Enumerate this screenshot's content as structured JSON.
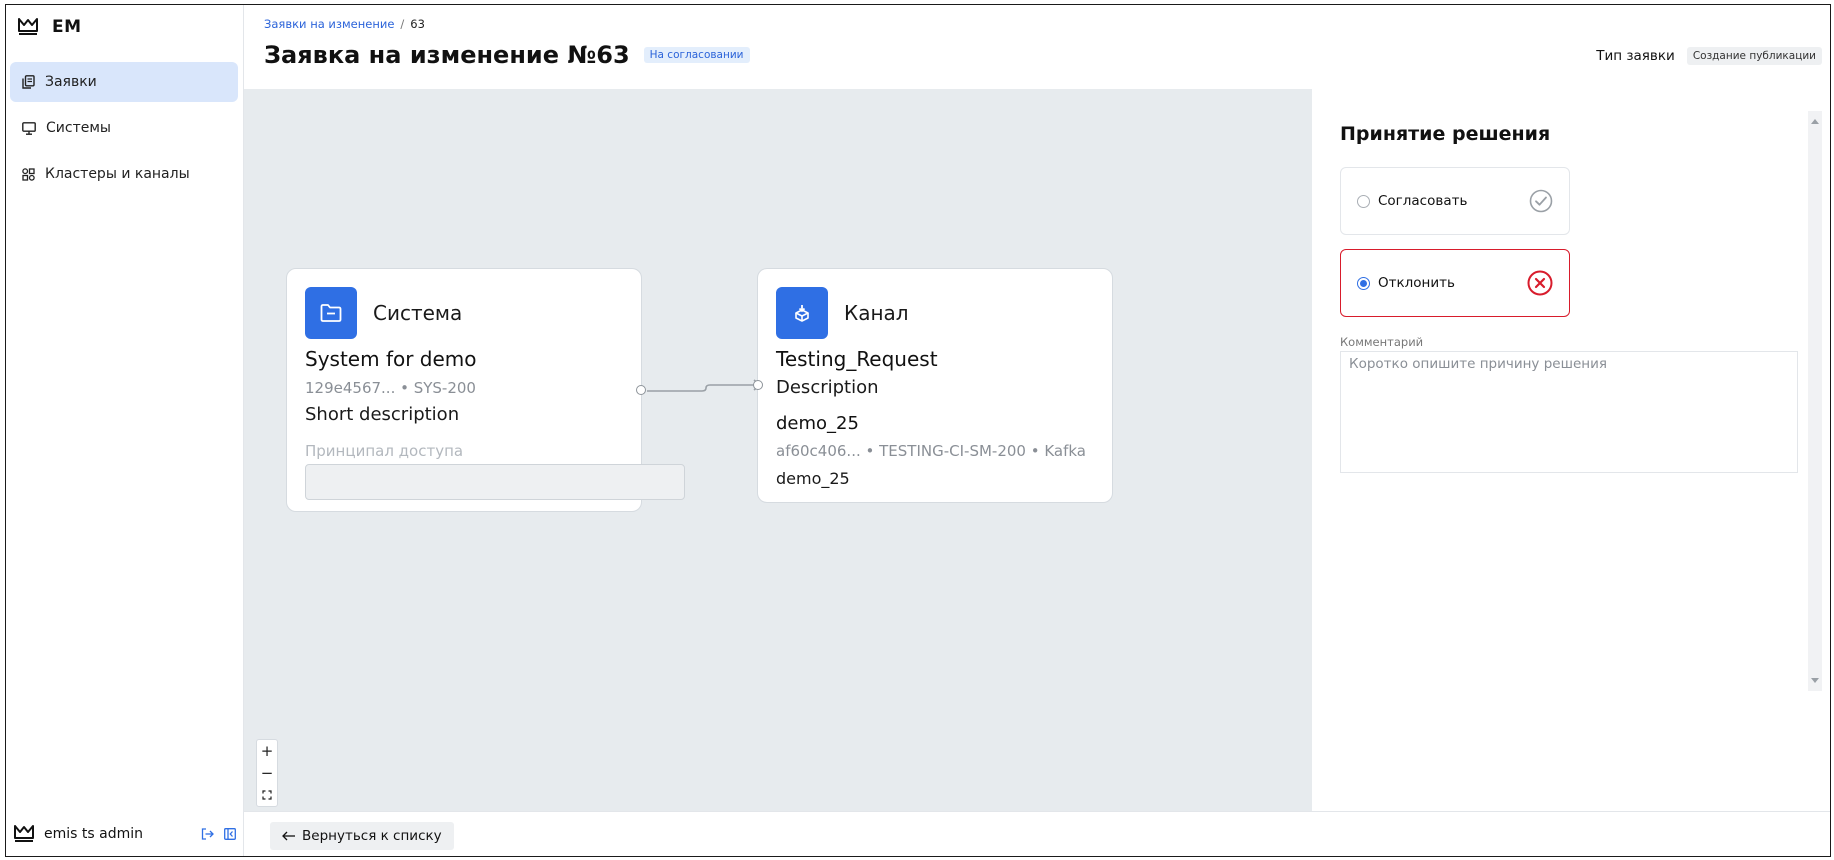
{
  "sidebar": {
    "brand": "EM",
    "items": [
      {
        "label": "Заявки",
        "icon": "copy-icon",
        "active": true
      },
      {
        "label": "Системы",
        "icon": "monitor-icon",
        "active": false
      },
      {
        "label": "Кластеры и каналы",
        "icon": "grid-icon",
        "active": false
      }
    ],
    "user": {
      "name": "emis ts admin",
      "logout_icon": "logout-icon",
      "collapse_icon": "collapse-sidebar-icon"
    }
  },
  "header": {
    "breadcrumb": {
      "link": "Заявки на изменение",
      "separator": "/",
      "current": "63"
    },
    "title": "Заявка на изменение №63",
    "status": "На согласовании",
    "request_type_label": "Тип заявки",
    "request_type_value": "Создание публикации"
  },
  "canvas": {
    "system_node": {
      "kind": "Система",
      "icon": "folder-icon",
      "name": "System for demo",
      "meta": "129e4567... • SYS-200",
      "description": "Short description",
      "principal_label": "Принципал доступа"
    },
    "channel_node": {
      "kind": "Канал",
      "icon": "channel-icon",
      "name": "Testing_Request",
      "description": "Description",
      "cluster_name": "demo_25",
      "cluster_meta": "af60c406... • TESTING-CI-SM-200 • Kafka",
      "cluster_description": "demo_25"
    },
    "zoom": {
      "in": "+",
      "out": "−",
      "fit": "⛶"
    }
  },
  "decision": {
    "title": "Принятие решения",
    "options": [
      {
        "label": "Согласовать",
        "icon": "check-circle-icon",
        "selected": false
      },
      {
        "label": "Отклонить",
        "icon": "x-circle-icon",
        "selected": true
      }
    ],
    "comment_label": "Комментарий",
    "comment_placeholder": "Коротко опишите причину решения"
  },
  "footer": {
    "back_label": "Вернуться к списку"
  },
  "colors": {
    "accent": "#2f6fe4",
    "reject": "#d81c2c",
    "active_nav": "#d9e6fb",
    "canvas_bg": "#e7ebee"
  }
}
